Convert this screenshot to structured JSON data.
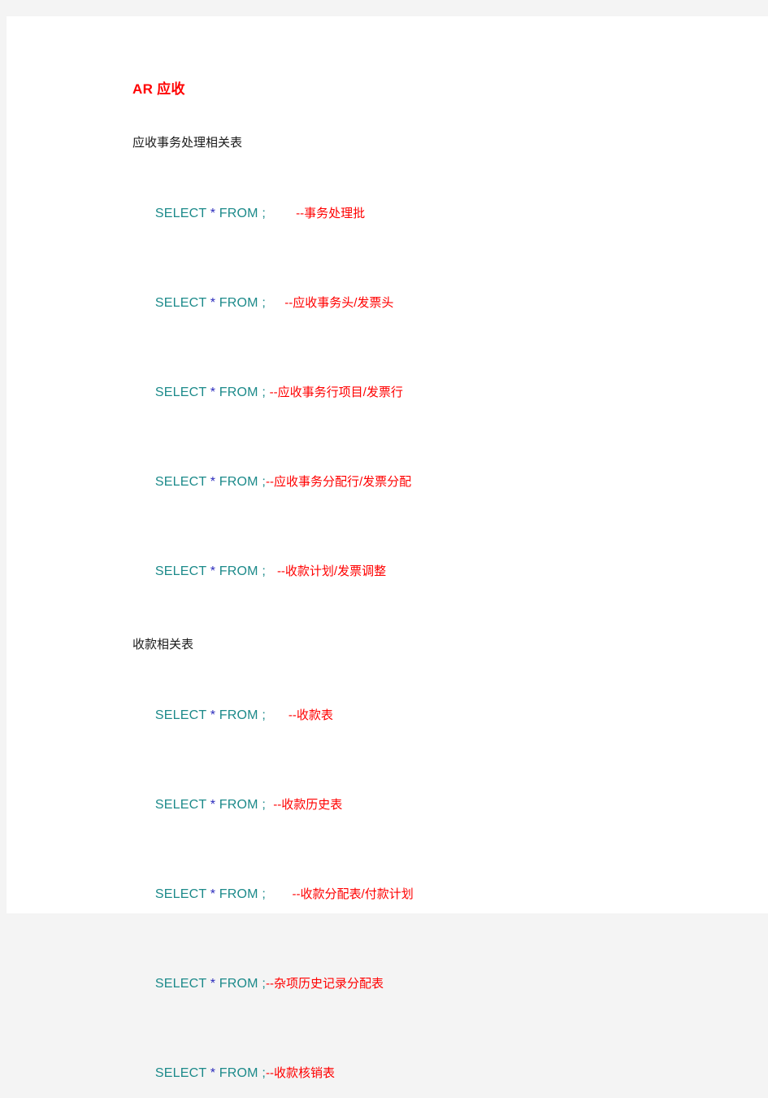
{
  "document": {
    "title": "AR  应收",
    "title_color": "#ff0000",
    "page_background": "#ffffff",
    "canvas_background": "#f4f4f4",
    "keyword_color": "#1c8a8a",
    "star_color": "#2b2bbd",
    "comment_color": "#ff0000",
    "header_color": "#1a1a1a"
  },
  "sections": [
    {
      "header": "应收事务处理相关表",
      "lines": [
        {
          "select": "SELECT",
          "star": "*",
          "from": "FROM",
          "semicolon": ";",
          "gap": "        ",
          "comment": "--事务处理批"
        },
        {
          "select": "SELECT",
          "star": "*",
          "from": "FROM",
          "semicolon": ";",
          "gap": "     ",
          "comment": "--应收事务头/发票头"
        },
        {
          "select": "SELECT",
          "star": "*",
          "from": "FROM",
          "semicolon": ";",
          "gap": " ",
          "comment": "--应收事务行项目/发票行"
        },
        {
          "select": "SELECT",
          "star": "*",
          "from": "FROM",
          "semicolon": ";",
          "gap": "",
          "comment": "--应收事务分配行/发票分配"
        },
        {
          "select": "SELECT",
          "star": "*",
          "from": "FROM",
          "semicolon": ";",
          "gap": "   ",
          "comment": "--收款计划/发票调整"
        }
      ]
    },
    {
      "header": "收款相关表",
      "lines": [
        {
          "select": "SELECT",
          "star": "*",
          "from": "FROM",
          "semicolon": ";",
          "gap": "      ",
          "comment": "--收款表"
        },
        {
          "select": "SELECT",
          "star": "*",
          "from": "FROM",
          "semicolon": ";",
          "gap": "  ",
          "comment": "--收款历史表"
        },
        {
          "select": "SELECT",
          "star": "*",
          "from": "FROM",
          "semicolon": ";",
          "gap": "       ",
          "comment": "--收款分配表/付款计划"
        },
        {
          "select": "SELECT",
          "star": "*",
          "from": "FROM",
          "semicolon": ";",
          "gap": "",
          "comment": "--杂项历史记录分配表"
        },
        {
          "select": "SELECT",
          "star": "*",
          "from": "FROM",
          "semicolon": ";",
          "gap": "",
          "comment": "--收款核销表"
        }
      ]
    }
  ]
}
